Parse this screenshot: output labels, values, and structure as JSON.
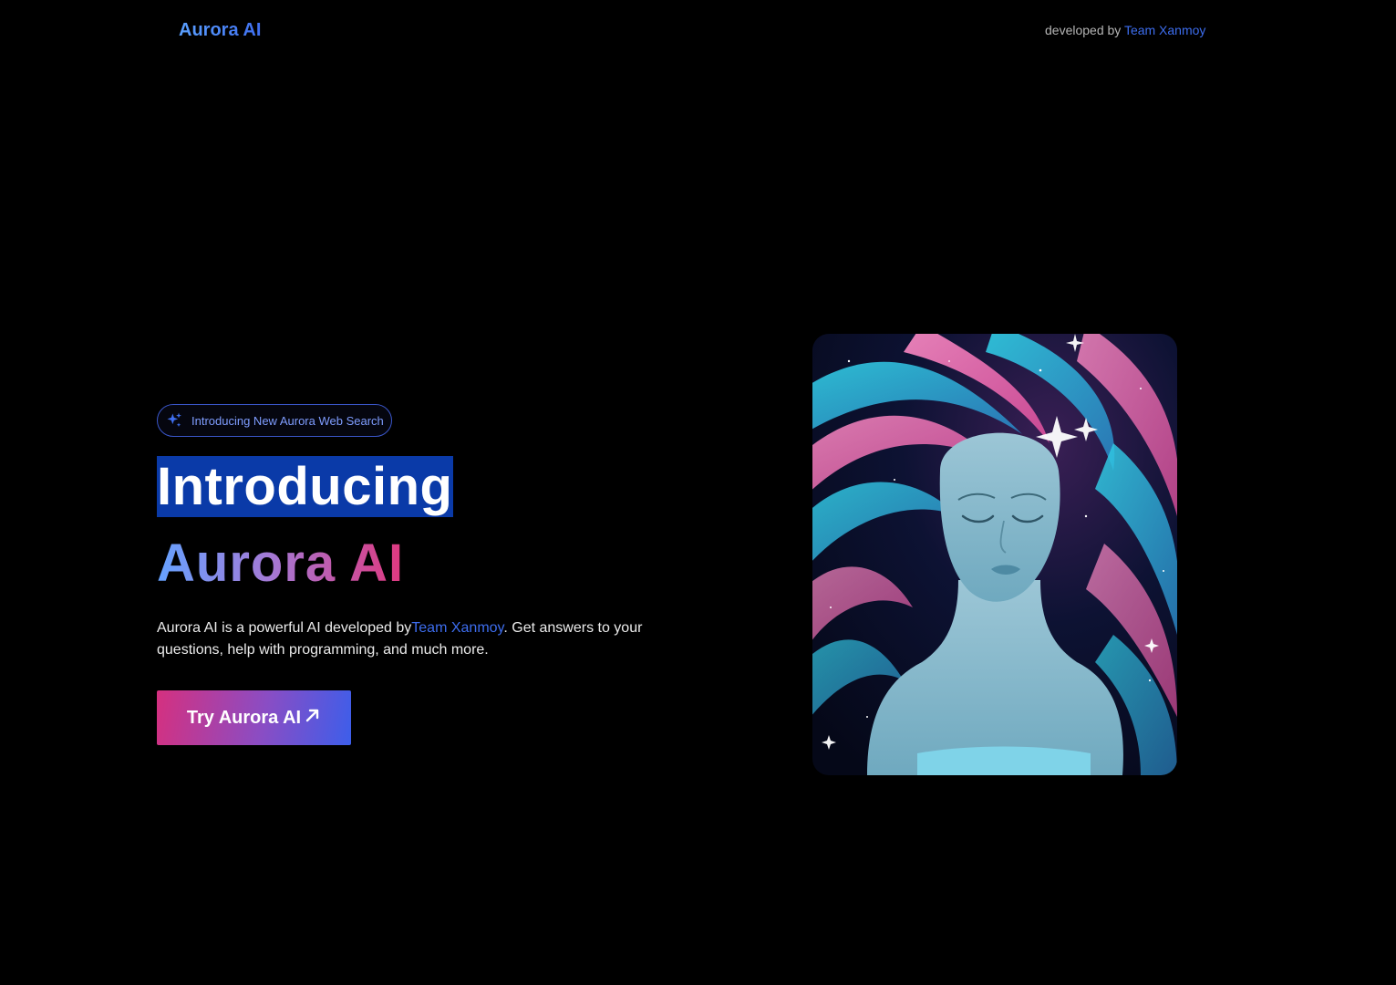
{
  "header": {
    "brand": "Aurora AI",
    "credit_prefix": "developed by",
    "credit_link": "Team Xanmoy"
  },
  "hero": {
    "pill_label": "Introducing New Aurora Web Search",
    "pill_icon": "sparkles-icon",
    "headline_line1": "Introducing",
    "headline_line2": "Aurora AI",
    "description_before": "Aurora AI is a powerful AI developed by",
    "description_link": "Team Xanmoy",
    "description_after": ". Get answers to your questions, help with programming, and much more.",
    "cta_label": "Try Aurora AI",
    "cta_icon": "arrow-up-right-icon"
  },
  "colors": {
    "background": "#000000",
    "accent_blue": "#3d6dee",
    "gradient_pink": "#e0387e",
    "gradient_purple": "#8a4dc4",
    "selection_blue": "#0a3aa8"
  }
}
